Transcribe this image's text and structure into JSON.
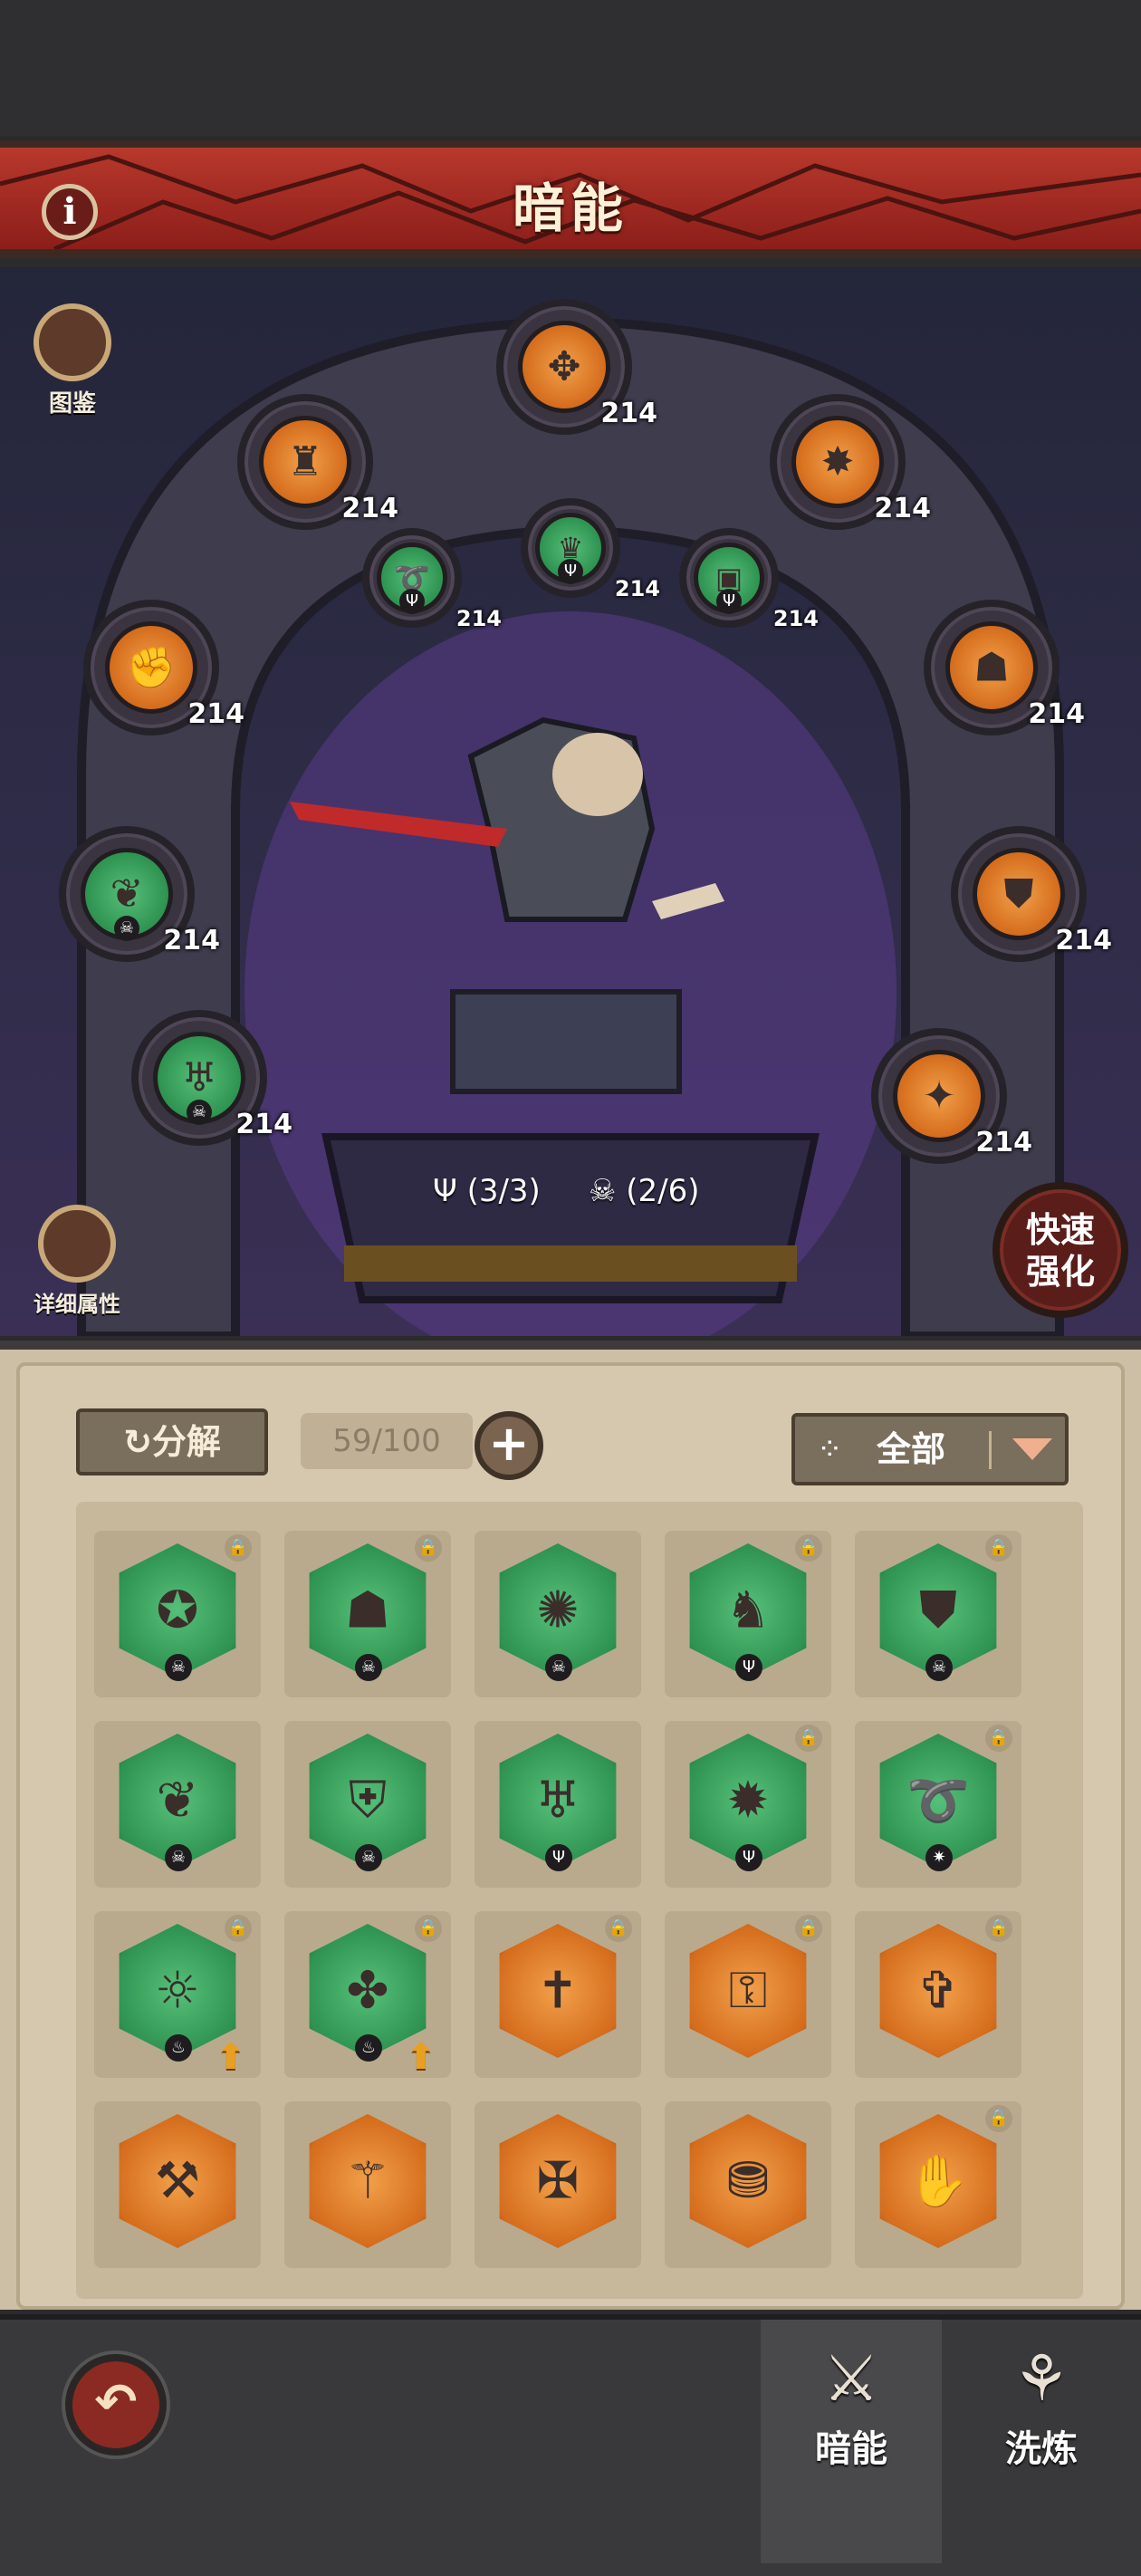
{
  "header": {
    "title": "暗能",
    "info_icon": "info-icon"
  },
  "side": {
    "codex_label": "图鉴",
    "details_label": "详细属性",
    "quick_label_1": "快速",
    "quick_label_2": "强化"
  },
  "ring_slots": [
    {
      "id": "top",
      "color": "orange",
      "level": "214",
      "icon": "axe-icon"
    },
    {
      "id": "upper-left",
      "color": "orange",
      "level": "214",
      "icon": "helmet-icon"
    },
    {
      "id": "upper-right",
      "color": "orange",
      "level": "214",
      "icon": "shield-icon"
    },
    {
      "id": "left",
      "color": "orange",
      "level": "214",
      "icon": "gauntlet-icon"
    },
    {
      "id": "right",
      "color": "orange",
      "level": "214",
      "icon": "mask-icon"
    },
    {
      "id": "mid-left",
      "color": "green",
      "level": "214",
      "icon": "wings-icon"
    },
    {
      "id": "mid-right",
      "color": "orange",
      "level": "214",
      "icon": "armor-icon"
    },
    {
      "id": "low-left",
      "color": "green",
      "level": "214",
      "icon": "cape-icon"
    },
    {
      "id": "low-right",
      "color": "orange",
      "level": "214",
      "icon": "star-shield-icon"
    },
    {
      "id": "inner-left",
      "color": "green",
      "level": "214",
      "icon": "whip-icon"
    },
    {
      "id": "inner-center",
      "color": "green",
      "level": "214",
      "icon": "crown-icon"
    },
    {
      "id": "inner-right",
      "color": "green",
      "level": "214",
      "icon": "chest-icon"
    }
  ],
  "set_counts": {
    "trident": "(3/3)",
    "skull": "(2/6)"
  },
  "inventory": {
    "dissolve_label": "分解",
    "capacity": "59/100",
    "filter_label": "全部"
  },
  "inventory_items": [
    {
      "color": "green",
      "lock": true
    },
    {
      "color": "green",
      "lock": true
    },
    {
      "color": "green",
      "lock": false
    },
    {
      "color": "green",
      "lock": true
    },
    {
      "color": "green",
      "lock": true
    },
    {
      "color": "green",
      "lock": false
    },
    {
      "color": "green",
      "lock": false
    },
    {
      "color": "green",
      "lock": false
    },
    {
      "color": "green",
      "lock": true
    },
    {
      "color": "green",
      "lock": true
    },
    {
      "color": "green",
      "lock": true,
      "up": true
    },
    {
      "color": "green",
      "lock": true,
      "up": true
    },
    {
      "color": "orange",
      "lock": true
    },
    {
      "color": "orange",
      "lock": true
    },
    {
      "color": "orange",
      "lock": true
    },
    {
      "color": "orange",
      "lock": false
    },
    {
      "color": "orange",
      "lock": false
    },
    {
      "color": "orange",
      "lock": false
    },
    {
      "color": "orange",
      "lock": false
    },
    {
      "color": "orange",
      "lock": true
    }
  ],
  "bottom_nav": {
    "dark_energy": "暗能",
    "refine": "洗炼"
  },
  "colors": {
    "banner": "#a82a22",
    "green": "#2e9250",
    "orange": "#d46c1c",
    "panel": "#d6c8ae"
  }
}
